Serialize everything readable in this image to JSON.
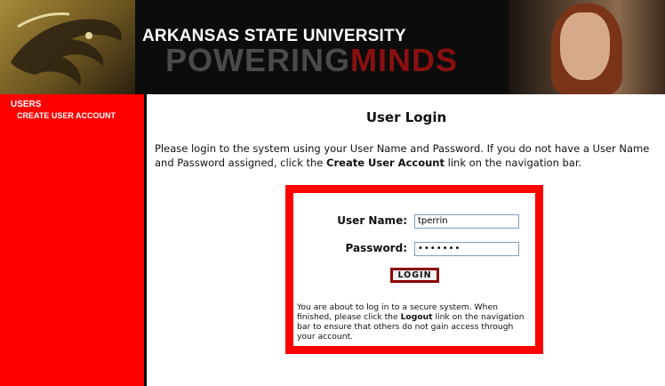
{
  "header": {
    "title": "ARKANSAS STATE UNIVERSITY",
    "tagline_part1": "POWERING",
    "tagline_part2": "MINDS",
    "logo_icon": "red-wolf-logo-icon",
    "photo_icon": "student-photo-icon"
  },
  "sidebar": {
    "heading": "USERS",
    "items": [
      {
        "label": "CREATE USER ACCOUNT"
      }
    ]
  },
  "main": {
    "title": "User Login",
    "intro_part1": "Please login to the system using your User Name and Password. If you do not have a User Name and Password assigned, click the ",
    "intro_bold": "Create User Account",
    "intro_part2": " link on the navigation bar."
  },
  "login": {
    "username_label": "User Name:",
    "username_value": "tperrin",
    "password_label": "Password:",
    "password_value": "•••••••",
    "button_label": "LOGIN",
    "message_part1": "You are about to log in to a secure system. When finished, please click the ",
    "message_bold": "Logout",
    "message_part2": " link on the navigation bar to ensure that others do not gain access through your account."
  },
  "colors": {
    "accent": "#ff0000",
    "header_bg": "#0c0c0c",
    "button_border": "#8b0000"
  }
}
